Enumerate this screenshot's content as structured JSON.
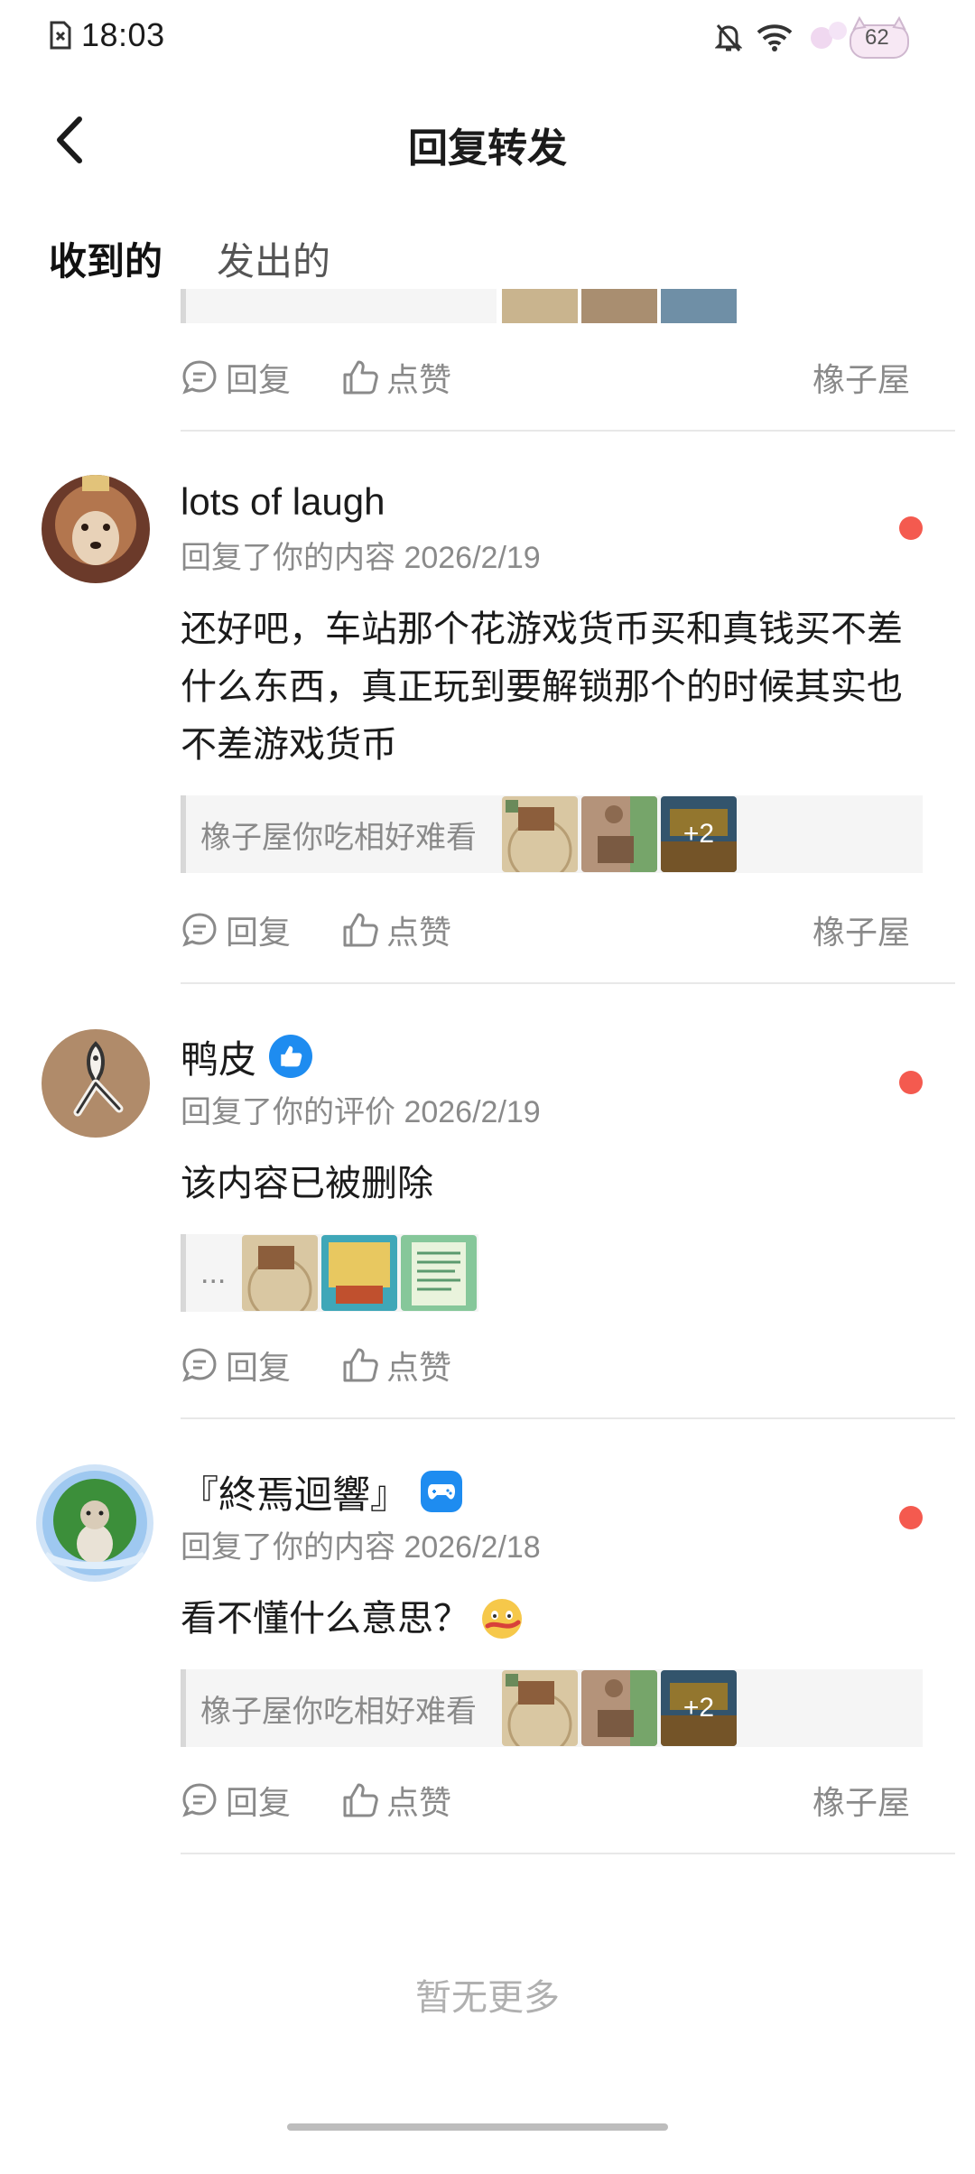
{
  "status_bar": {
    "time": "18:03",
    "battery": "62"
  },
  "header": {
    "title": "回复转发"
  },
  "tabs": [
    {
      "label": "收到的",
      "active": true
    },
    {
      "label": "发出的",
      "active": false
    }
  ],
  "actions": {
    "reply": "回复",
    "like": "点赞"
  },
  "partial_item": {
    "source": "橡子屋"
  },
  "items": [
    {
      "name": "lots of laugh",
      "meta": "回复了你的内容 2026/2/19",
      "comment": "还好吧，车站那个花游戏货币买和真钱买不差什么东西，真正玩到要解锁那个的时候其实也不差游戏货币",
      "quote": "橡子屋你吃相好难看",
      "more_count": "+2",
      "source": "橡子屋"
    },
    {
      "name": "鸭皮",
      "meta": "回复了你的评价 2026/2/19",
      "comment": "该内容已被删除",
      "quote": "...",
      "source": ""
    },
    {
      "name": "『終焉迴響』",
      "meta": "回复了你的内容 2026/2/18",
      "comment": "看不懂什么意思？",
      "quote": "橡子屋你吃相好难看",
      "more_count": "+2",
      "source": "橡子屋"
    }
  ],
  "footer": {
    "end_text": "暂无更多"
  },
  "colors": {
    "accent": "#2ad7c7",
    "unread": "#f45a4f",
    "badge": "#1e8cf0"
  }
}
